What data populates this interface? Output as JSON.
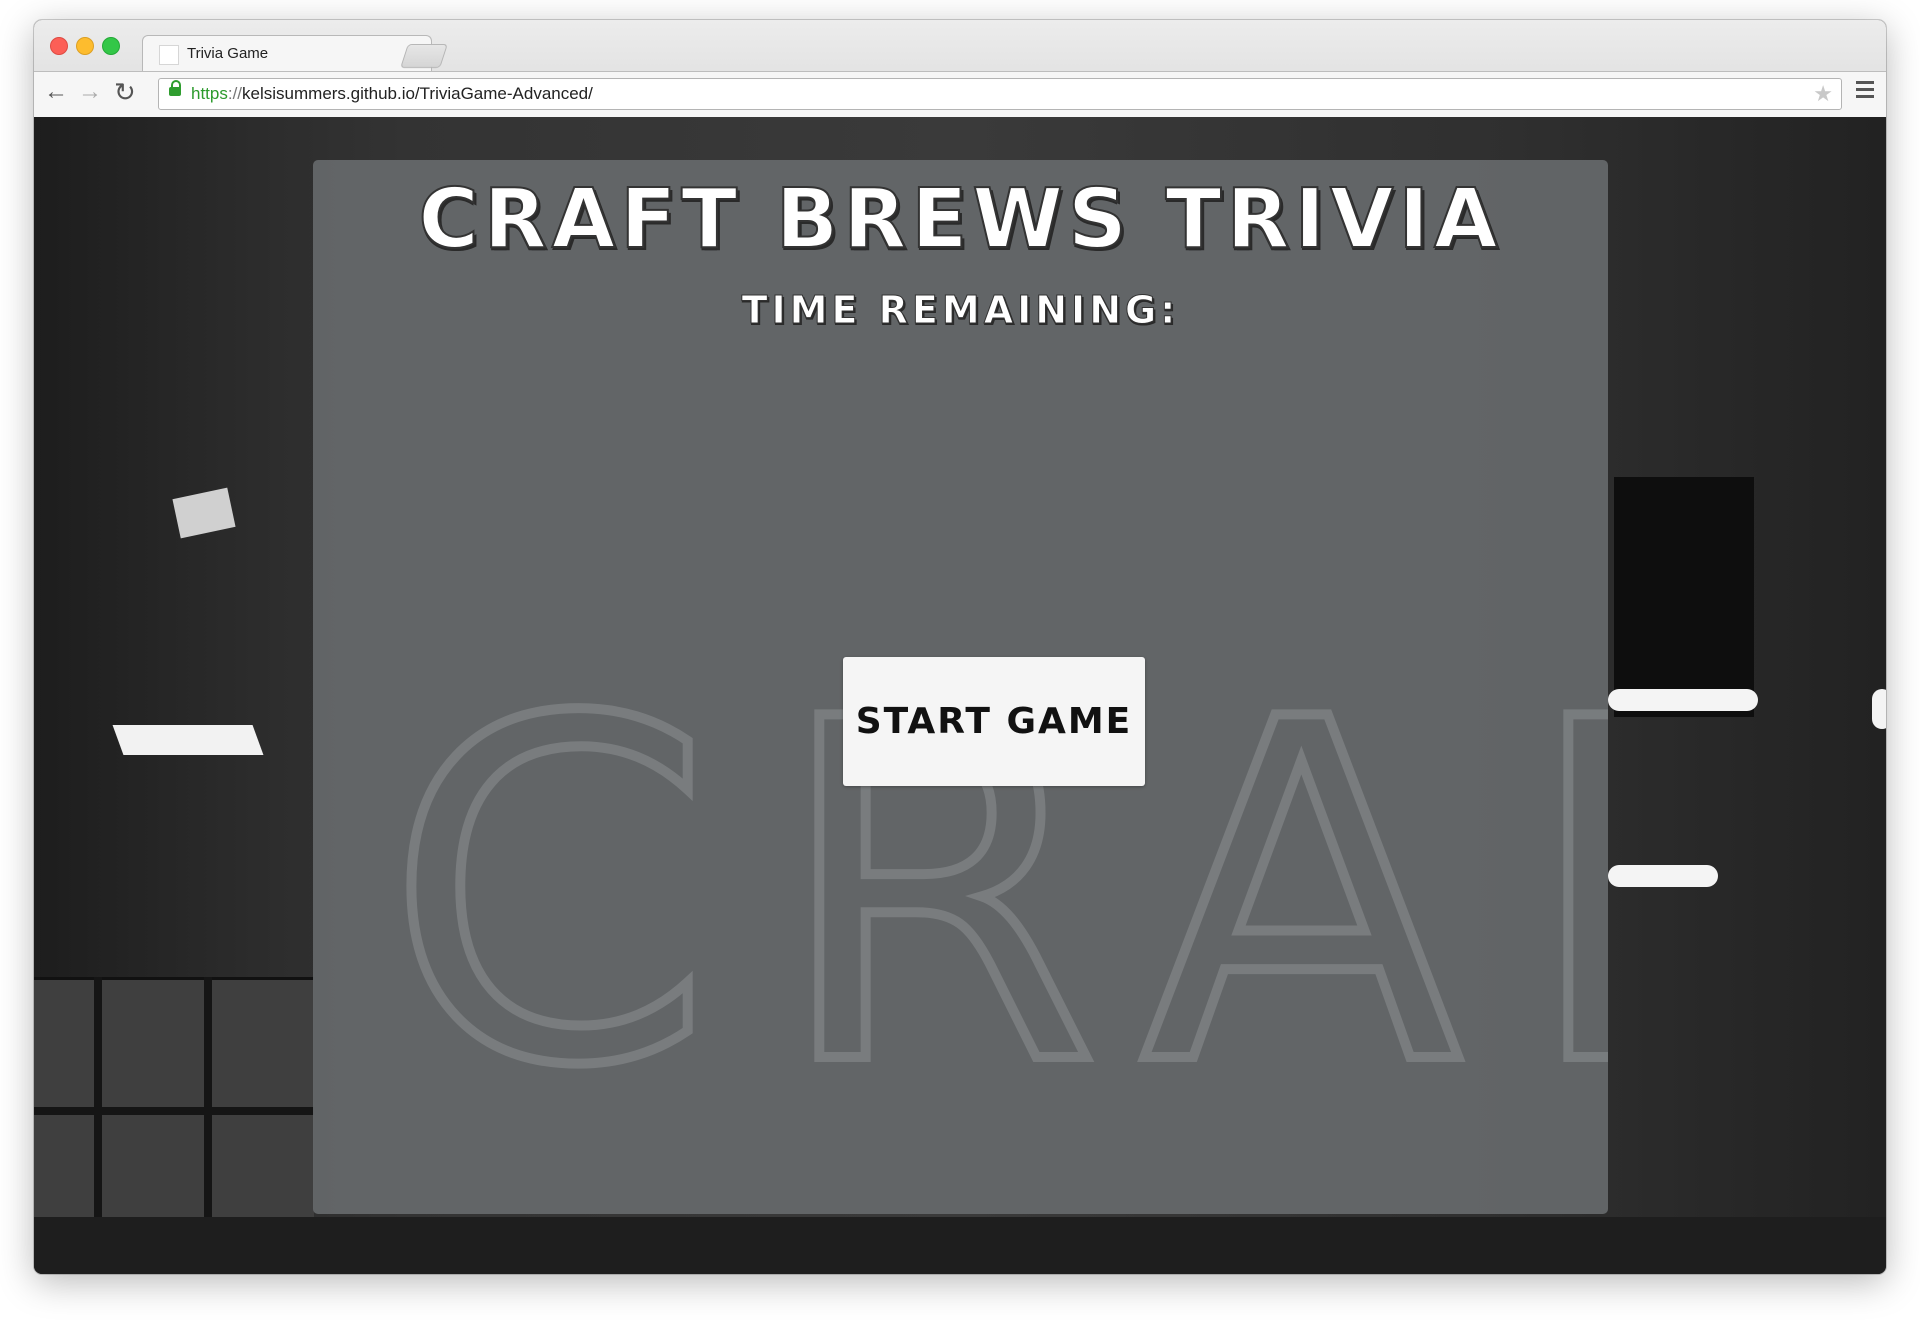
{
  "browser": {
    "tab": {
      "title": "Trivia Game",
      "close_glyph": "×"
    },
    "nav": {
      "back_glyph": "←",
      "forward_glyph": "→",
      "reload_glyph": "↻"
    },
    "address": {
      "scheme": "https",
      "separator": "://",
      "rest": "kelsisummers.github.io/TriviaGame-Advanced/"
    },
    "bookmark_glyph": "★"
  },
  "page": {
    "title": "Craft Brews Trivia",
    "timer_label": "Time Remaining:",
    "start_button_label": "Start Game"
  },
  "colors": {
    "panel": "#65686a",
    "button_bg": "#f5f5f5",
    "url_scheme": "#2c9a2c"
  }
}
